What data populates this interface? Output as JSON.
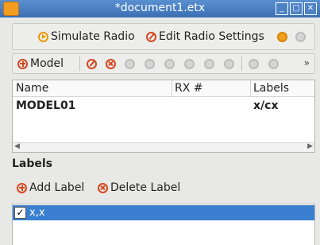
{
  "window": {
    "title": "*document1.etx"
  },
  "toolbar_top": {
    "simulate_label": "Simulate Radio",
    "edit_settings_label": "Edit Radio Settings"
  },
  "model_toolbar": {
    "model_label": "Model",
    "overflow": "»"
  },
  "models_table": {
    "columns": [
      "Name",
      "RX #",
      "Labels"
    ],
    "rows": [
      {
        "name": "MODEL01",
        "rx": "",
        "labels": "x/cx"
      }
    ]
  },
  "labels_section": {
    "heading": "Labels",
    "add_label": "Add Label",
    "delete_label": "Delete Label",
    "items": [
      {
        "text": "x,x",
        "checked": true
      }
    ]
  },
  "icons": {
    "app": "app-icon",
    "simulate": "play-icon",
    "edit": "edit-icon",
    "add": "add-icon",
    "delete": "delete-icon"
  },
  "colors": {
    "titlebar": "#3a6fb4",
    "selection": "#3a7fcf",
    "accent": "#d3491f",
    "play": "#e89a00"
  }
}
